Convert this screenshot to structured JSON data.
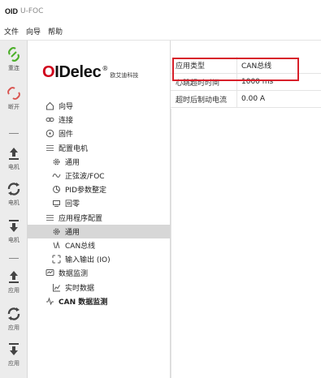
{
  "window": {
    "logo_prefix": "OID",
    "title": "U-FOC"
  },
  "menu": [
    {
      "label": "文件"
    },
    {
      "label": "向导"
    },
    {
      "label": "帮助"
    }
  ],
  "toolbar": [
    {
      "label": "重连",
      "icon": "reconnect-icon"
    },
    {
      "label": "断开",
      "icon": "disconnect-icon"
    },
    {
      "label": "电机",
      "icon": "upload-icon"
    },
    {
      "label": "电机",
      "icon": "refresh-icon"
    },
    {
      "label": "电机",
      "icon": "download-icon"
    },
    {
      "label": "应用",
      "icon": "upload-icon"
    },
    {
      "label": "应用",
      "icon": "refresh-icon"
    },
    {
      "label": "应用",
      "icon": "download-icon"
    }
  ],
  "brand": {
    "name_red": "O",
    "name_rest": "IDelec",
    "reg": "®",
    "subtitle": "欧艾迪科技"
  },
  "tree": [
    {
      "label": "向导",
      "level": 1,
      "icon": "home-icon"
    },
    {
      "label": "连接",
      "level": 1,
      "icon": "link-icon"
    },
    {
      "label": "固件",
      "level": 1,
      "icon": "chip-icon"
    },
    {
      "label": "配置电机",
      "level": 1,
      "icon": "list-icon"
    },
    {
      "label": "通用",
      "level": 2,
      "icon": "gear-icon"
    },
    {
      "label": "正弦波/FOC",
      "level": 2,
      "icon": "wave-icon"
    },
    {
      "label": "PID参数整定",
      "level": 2,
      "icon": "pid-icon"
    },
    {
      "label": "回零",
      "level": 2,
      "icon": "home-return-icon"
    },
    {
      "label": "应用程序配置",
      "level": 1,
      "icon": "list-icon"
    },
    {
      "label": "通用",
      "level": 2,
      "icon": "gear-icon",
      "selected": true
    },
    {
      "label": "CAN总线",
      "level": 2,
      "icon": "can-icon"
    },
    {
      "label": "输入输出 (IO)",
      "level": 2,
      "icon": "io-icon"
    },
    {
      "label": "数据监测",
      "level": 1,
      "icon": "monitor-icon"
    },
    {
      "label": "实时数据",
      "level": 2,
      "icon": "chart-icon"
    },
    {
      "label": "CAN 数据监测",
      "level": 1,
      "icon": "can-monitor-icon",
      "bold": true
    }
  ],
  "properties": [
    {
      "key": "应用类型",
      "value": "CAN总线"
    },
    {
      "key": "心跳超时时间",
      "value": "1000 ms"
    },
    {
      "key": "超时后制动电流",
      "value": "0.00 A"
    }
  ],
  "colors": {
    "brand_red": "#d0021b",
    "highlight_border": "#d8202a",
    "selection_bg": "#d7d7d7",
    "toolbar_bg": "#ececec",
    "reconnect_green": "#4caf2a",
    "disconnect_red": "#d9534f"
  }
}
